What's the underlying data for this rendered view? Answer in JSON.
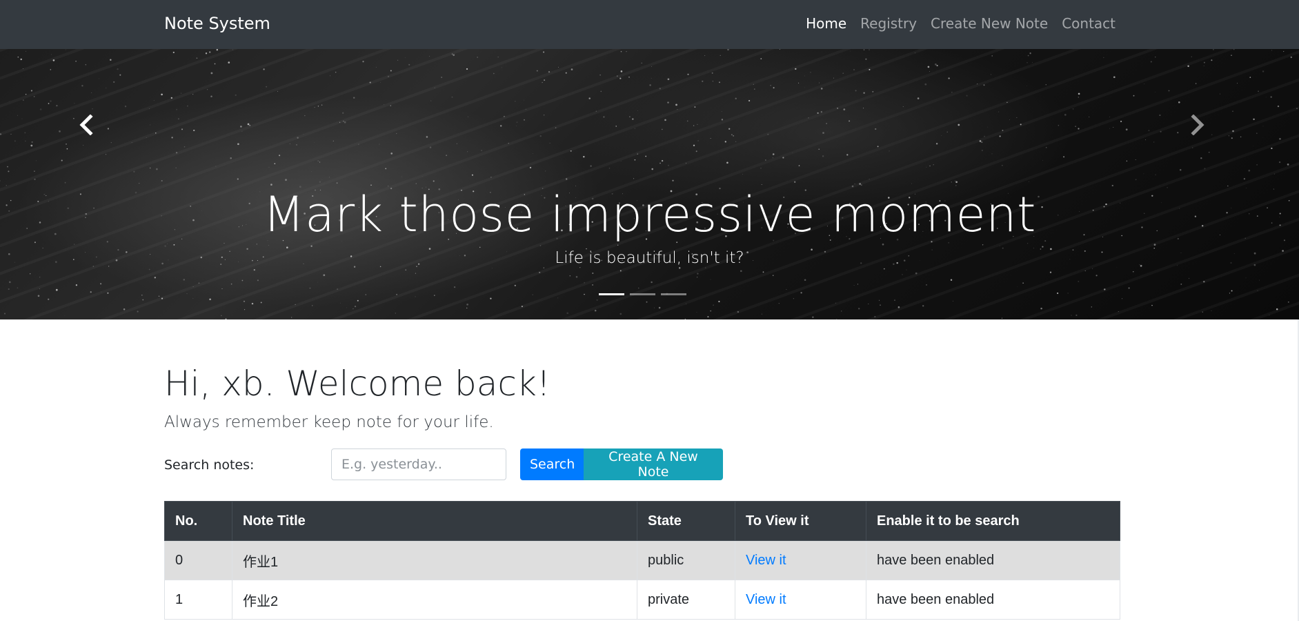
{
  "navbar": {
    "brand": "Note System",
    "links": [
      {
        "label": "Home",
        "active": true
      },
      {
        "label": "Registry",
        "active": false
      },
      {
        "label": "Create New Note",
        "active": false
      },
      {
        "label": "Contact",
        "active": false
      }
    ]
  },
  "carousel": {
    "title": "Mark those impressive moment",
    "subtitle": "Life is beautiful, isn't it?",
    "prev_icon": "chevron-left-icon",
    "next_icon": "chevron-right-icon",
    "slide_count": 3,
    "active_slide": 1
  },
  "main": {
    "greeting": "Hi, xb. Welcome back!",
    "lead": "Always remember keep note for your life.",
    "search_label": "Search notes:",
    "search_placeholder": "E.g. yesterday..",
    "search_value": "",
    "search_button": "Search",
    "create_button": "Create A New Note"
  },
  "table": {
    "headers": [
      "No.",
      "Note Title",
      "State",
      "To View it",
      "Enable it to be search"
    ],
    "rows": [
      {
        "no": "0",
        "title": "作业1",
        "state": "public",
        "view": "View it",
        "search": "have been enabled"
      },
      {
        "no": "1",
        "title": "作业2",
        "state": "private",
        "view": "View it",
        "search": "have been enabled"
      }
    ]
  },
  "colors": {
    "navbar_bg": "#343a40",
    "primary": "#007bff",
    "info": "#17a2b8",
    "table_header_bg": "#343a40",
    "striped_row": "#dedede"
  }
}
